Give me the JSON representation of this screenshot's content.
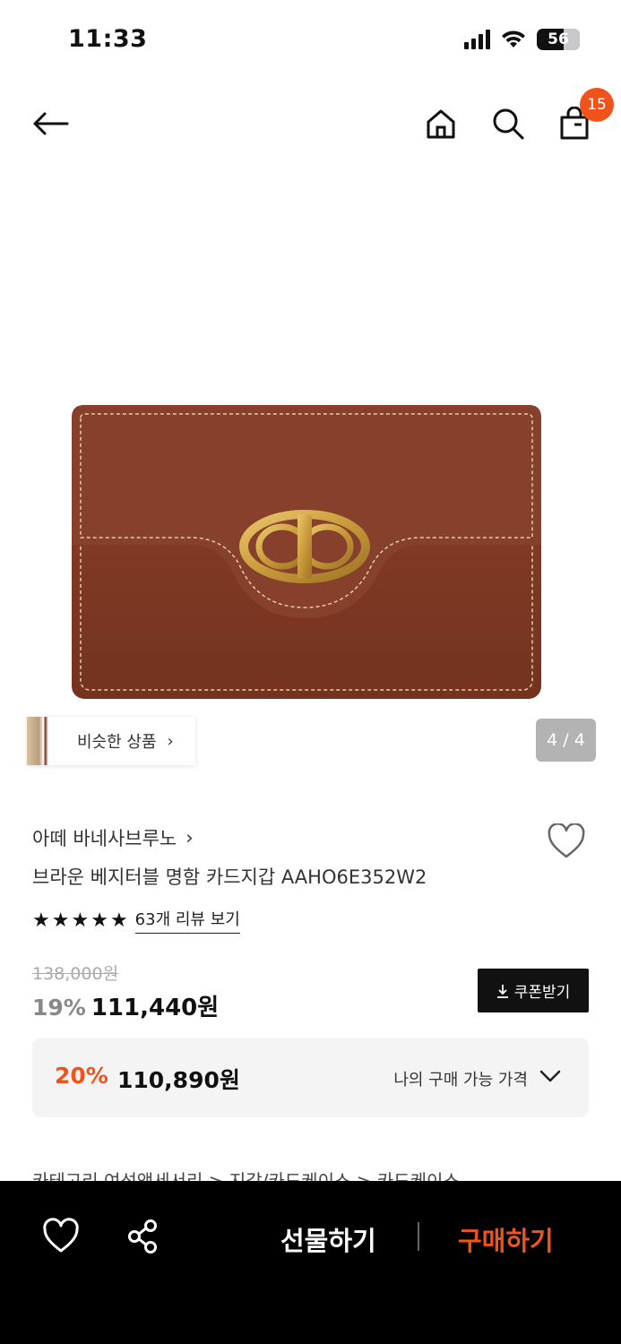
{
  "status_bar": {
    "time": "11:33",
    "battery": "56"
  },
  "nav": {
    "cart_count": "15"
  },
  "gallery": {
    "similar_label": "비슷한 상품",
    "similar_chevron": "›",
    "counter": "4 / 4"
  },
  "product": {
    "brand": "아떼 바네사브루노",
    "brand_chevron": "›",
    "name": "브라운 베지터블 명함 카드지갑 AAHO6E352W2",
    "rating_stars": 5,
    "review_link": "63개 리뷰 보기",
    "original_price": "138,000원",
    "discount": "19%",
    "sale_price": "111,440원",
    "coupon_label": "쿠폰받기"
  },
  "my_price": {
    "discount": "20%",
    "price": "110,890원",
    "label": "나의 구매 가능 가격"
  },
  "breadcrumb": "카테고리      여성액세서리  >  지갑/카드케이스  >  카드케이스",
  "bottom_bar": {
    "gift_label": "선물하기",
    "buy_label": "구매하기"
  },
  "icons": {
    "back": "arrow-left-icon",
    "home": "home-icon",
    "search": "search-icon",
    "cart": "shopping-bag-icon",
    "wish": "heart-icon",
    "share": "share-icon",
    "download": "download-icon",
    "chevron": "chevron-down-icon"
  },
  "colors": {
    "accent": "#f0531c",
    "bottom_bar": "#000000",
    "price_box": "#f4f4f4"
  }
}
